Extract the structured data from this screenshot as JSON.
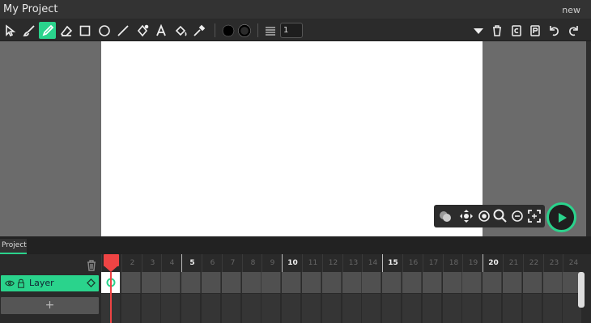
{
  "window": {
    "title": "My Project",
    "new_label": "new"
  },
  "toolbar": {
    "tools": [
      "cursor-icon",
      "brush-icon",
      "pencil-icon",
      "eraser-icon",
      "rectangle-icon",
      "ellipse-icon",
      "line-icon",
      "path-icon",
      "text-icon",
      "fill-bucket-icon",
      "eyedropper-icon"
    ],
    "active_tool": "pencil-icon",
    "fill_color": "#000000",
    "stroke_color": "#000000",
    "stroke_width": "1",
    "right_tools": [
      "dropdown-icon",
      "trash-icon",
      "copy-icon",
      "paste-icon",
      "undo-icon",
      "redo-icon"
    ]
  },
  "stage_controls": [
    "onion-skin-icon",
    "pan-icon",
    "zoom-reset-icon",
    "zoom-in-icon",
    "zoom-out-icon",
    "fullscreen-icon",
    "play-icon"
  ],
  "timeline": {
    "tab_label": "Project",
    "layers": [
      {
        "name": "Layer"
      }
    ],
    "add_label": "+",
    "frame_numbers": [
      "1",
      "2",
      "3",
      "4",
      "5",
      "6",
      "7",
      "8",
      "9",
      "10",
      "11",
      "12",
      "13",
      "14",
      "15",
      "16",
      "17",
      "18",
      "19",
      "20",
      "21",
      "22",
      "23",
      "24"
    ],
    "major_frames": [
      "5",
      "10",
      "15",
      "20"
    ],
    "current_frame": 1
  },
  "colors": {
    "accent": "#2ad38c",
    "playhead": "#ee4444"
  }
}
